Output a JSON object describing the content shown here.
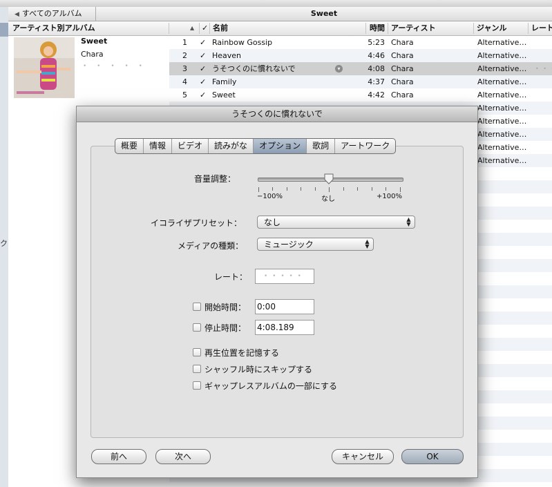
{
  "library": {
    "back_label": "すべてのアルバム",
    "album_title": "Sweet",
    "sidebar_fragment": "ク",
    "columns": {
      "artist_album": "アーティスト別アルバム",
      "check": "✓",
      "name": "名前",
      "time": "時間",
      "artist": "アーティスト",
      "genre": "ジャンル",
      "rating": "レート"
    },
    "album": {
      "name": "Sweet",
      "artist": "Chara",
      "rating": "• • • • •"
    },
    "tracks": [
      {
        "num": "1",
        "check": "✓",
        "name": "Rainbow Gossip",
        "time": "5:23",
        "artist": "Chara",
        "genre": "Alternative…",
        "rating": ""
      },
      {
        "num": "2",
        "check": "✓",
        "name": "Heaven",
        "time": "4:46",
        "artist": "Chara",
        "genre": "Alternative…",
        "rating": ""
      },
      {
        "num": "3",
        "check": "✓",
        "name": "うそつくのに慣れないで",
        "time": "4:08",
        "artist": "Chara",
        "genre": "Alternative…",
        "rating": "• • • • •"
      },
      {
        "num": "4",
        "check": "✓",
        "name": "Family",
        "time": "4:37",
        "artist": "Chara",
        "genre": "Alternative…",
        "rating": ""
      },
      {
        "num": "5",
        "check": "✓",
        "name": "Sweet",
        "time": "4:42",
        "artist": "Chara",
        "genre": "Alternative…",
        "rating": ""
      }
    ],
    "covered_rows": [
      {
        "genre": "Alternative…"
      },
      {
        "genre": "Alternative…"
      },
      {
        "genre": "Alternative…"
      },
      {
        "genre": "Alternative…"
      },
      {
        "genre": "Alternative…"
      }
    ]
  },
  "dialog": {
    "title": "うそつくのに慣れないで",
    "tabs": [
      "概要",
      "情報",
      "ビデオ",
      "読みがな",
      "オプション",
      "歌詞",
      "アートワーク"
    ],
    "active_tab": "オプション",
    "volume": {
      "label": "音量調整：",
      "min_label": "−100%",
      "mid_label": "なし",
      "max_label": "+100%",
      "value": 0
    },
    "equalizer": {
      "label": "イコライザプリセット：",
      "value": "なし"
    },
    "media_kind": {
      "label": "メディアの種類：",
      "value": "ミュージック"
    },
    "rating": {
      "label": "レート：",
      "value": "• • • • •"
    },
    "start_time": {
      "label": "開始時間：",
      "value": "0:00",
      "checked": false
    },
    "stop_time": {
      "label": "停止時間：",
      "value": "4:08.189",
      "checked": false
    },
    "options": [
      {
        "label": "再生位置を記憶する",
        "checked": false
      },
      {
        "label": "シャッフル時にスキップする",
        "checked": false
      },
      {
        "label": "ギャップレスアルバムの一部にする",
        "checked": false
      }
    ],
    "buttons": {
      "prev": "前へ",
      "next": "次へ",
      "cancel": "キャンセル",
      "ok": "OK"
    }
  }
}
